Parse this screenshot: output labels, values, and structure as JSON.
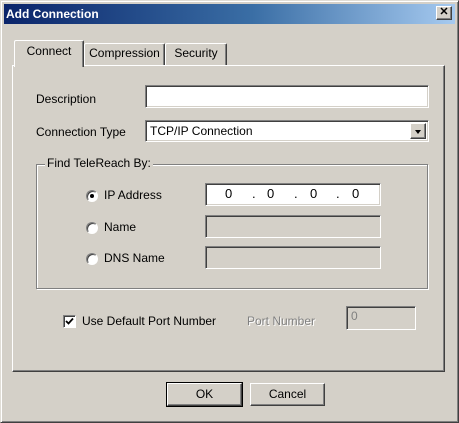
{
  "window": {
    "title": "Add Connection",
    "close_glyph": "✕"
  },
  "tabs": [
    {
      "label": "Connect",
      "active": true
    },
    {
      "label": "Compression",
      "active": false
    },
    {
      "label": "Security",
      "active": false
    }
  ],
  "connect": {
    "description_label": "Description",
    "description_value": "",
    "connection_type_label": "Connection Type",
    "connection_type_value": "TCP/IP Connection",
    "find_group_label": "Find TeleReach By:",
    "radios": [
      {
        "label": "IP Address",
        "checked": true
      },
      {
        "label": "Name",
        "checked": false
      },
      {
        "label": "DNS Name",
        "checked": false
      }
    ],
    "ip_octets": [
      "0",
      "0",
      "0",
      "0"
    ],
    "ip_separator": ".",
    "name_value": "",
    "dns_name_value": "",
    "use_default_port_label": "Use Default Port Number",
    "use_default_port_checked": true,
    "port_number_label": "Port Number",
    "port_number_value": "0"
  },
  "buttons": {
    "ok_label": "OK",
    "cancel_label": "Cancel"
  },
  "icons": {
    "close": "close-icon",
    "combo_arrow": "chevron-down-icon",
    "check": "checkmark-icon"
  },
  "colors": {
    "title_bar_start": "#0a246a",
    "title_bar_end": "#a6caf0",
    "face": "#d4d0c8"
  }
}
